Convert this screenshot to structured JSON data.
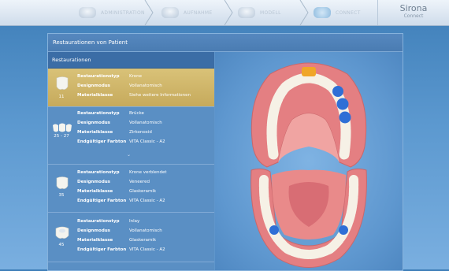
{
  "nav": {
    "steps": [
      {
        "label": "ADMINISTRATION",
        "icon": "administration-icon"
      },
      {
        "label": "AUFNAHME",
        "icon": "aufnahme-icon"
      },
      {
        "label": "MODELL",
        "icon": "modell-icon"
      },
      {
        "label": "CONNECT",
        "icon": "connect-icon"
      }
    ],
    "brand": {
      "name": "Sirona",
      "product": "Connect"
    }
  },
  "panel": {
    "title": "Restaurationen von Patient",
    "list_header": "Restaurationen"
  },
  "field_labels": {
    "type": "Restaurationstyp",
    "design": "Designmodus",
    "material": "Materialklasse",
    "shade": "Endgültiger Farbton"
  },
  "restorations": [
    {
      "teeth": "11",
      "type": "Krone",
      "design": "Vollanatomisch",
      "material": "Siehe weitere Informationen",
      "selected": true
    },
    {
      "teeth": "25 - 27",
      "type": "Brücke",
      "design": "Vollanatomisch",
      "material": "Zirkonoxid",
      "shade": "VITA Classic - A2"
    },
    {
      "teeth": "35",
      "type": "Krone verblendet",
      "design": "Veneered",
      "material": "Glaskeramik",
      "shade": "VITA Classic - A2"
    },
    {
      "teeth": "45",
      "type": "Inlay",
      "design": "Vollanatomisch",
      "material": "Glaskeramik",
      "shade": "VITA Classic - A2"
    }
  ],
  "colors": {
    "selected_row": "#d0b569",
    "gum": "#e47f82",
    "tooth_gold": "#f0a628",
    "tooth_blue": "#2f6fd6"
  }
}
